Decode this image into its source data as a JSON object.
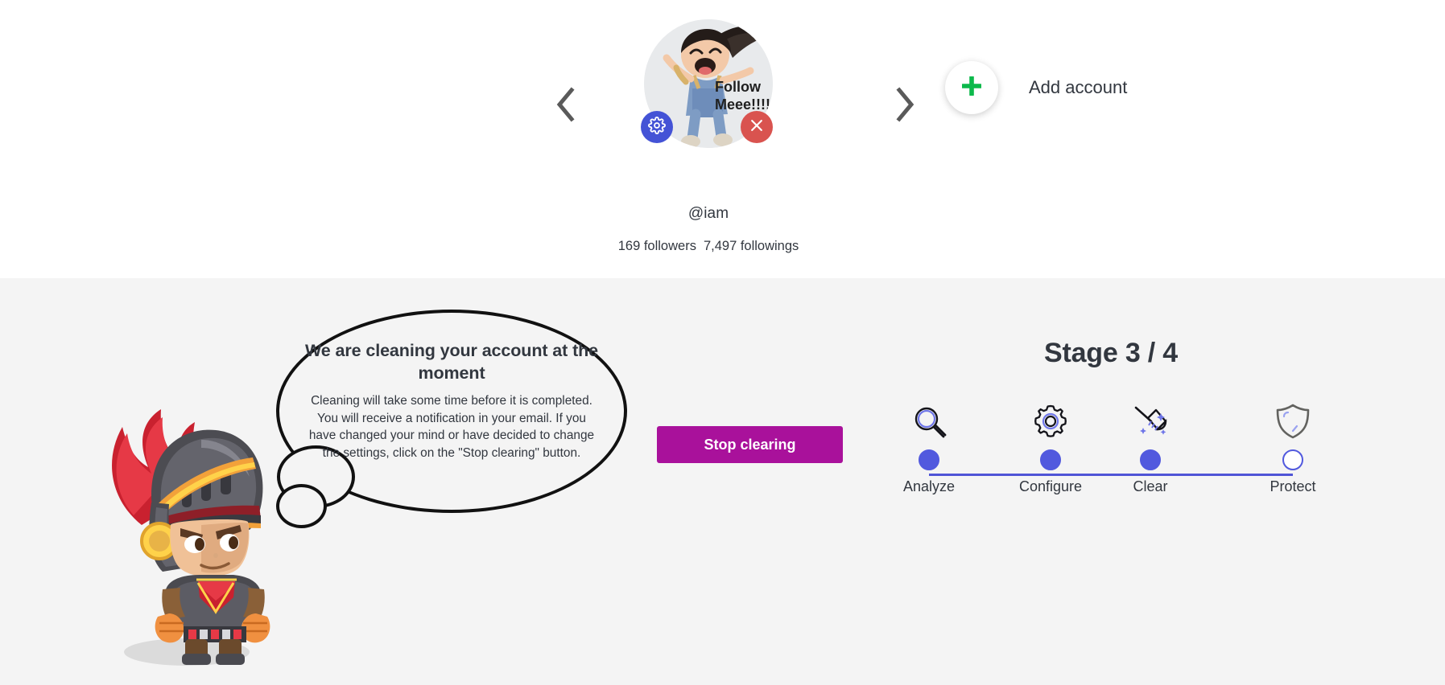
{
  "account_section": {
    "nav": {
      "prev_icon": "chevron-left-icon",
      "next_icon": "chevron-right-icon"
    },
    "account": {
      "handle": "@iam",
      "followers": "169 followers",
      "followings": "7,497 followings",
      "avatar_caption": "Follow Meee!!!!",
      "avatar_glow_color": "#3cd273",
      "settings_badge_icon": "gear-icon",
      "settings_badge_color": "#4453d6",
      "remove_badge_icon": "close-icon",
      "remove_badge_color": "#d9534f"
    },
    "add_account": {
      "label": "Add account",
      "icon": "plus-icon",
      "icon_color": "#0cb94b"
    }
  },
  "status_section": {
    "background_color": "#f4f4f4",
    "mascot": "knight-mascot",
    "bubble": {
      "title": "We are cleaning your account at the moment",
      "body": "Cleaning will take some time before it is completed. You will receive a notification in your email. If you have changed your mind or have decided to change the settings, click on the \"Stop clearing\" button."
    },
    "stop_button": {
      "label": "Stop clearing",
      "color": "#a9119b"
    },
    "stage": {
      "heading": "Stage 3 / 4",
      "accent_color": "#5159de",
      "steps": [
        {
          "label": "Analyze",
          "icon": "magnifier-icon",
          "state": "done"
        },
        {
          "label": "Configure",
          "icon": "gear-icon",
          "state": "done"
        },
        {
          "label": "Clear",
          "icon": "broom-icon",
          "state": "done"
        },
        {
          "label": "Protect",
          "icon": "shield-icon",
          "state": "todo"
        }
      ]
    }
  }
}
